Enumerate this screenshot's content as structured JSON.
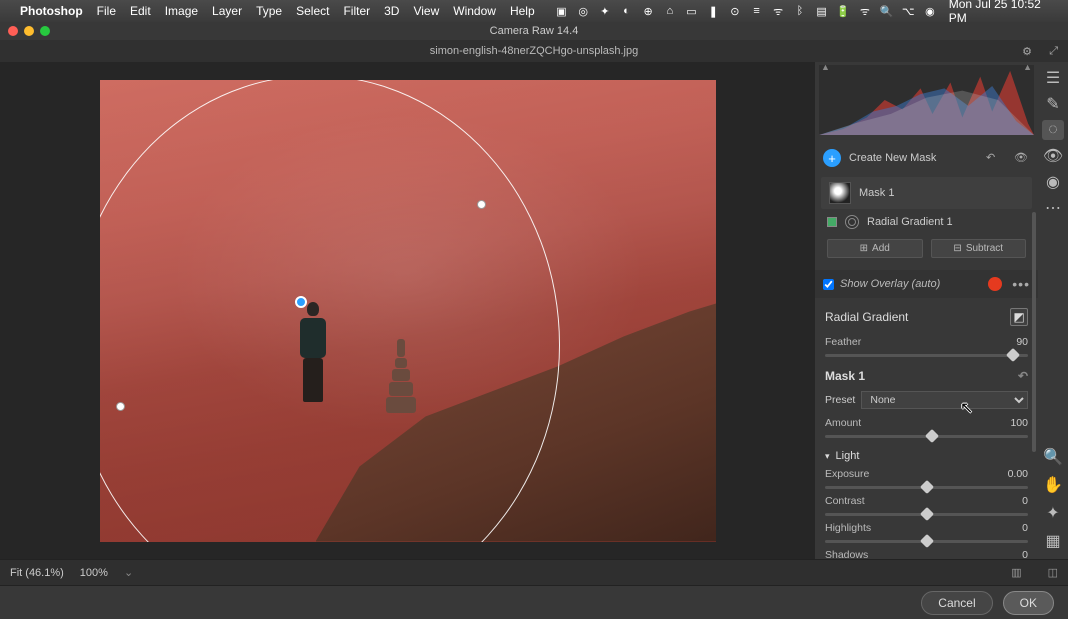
{
  "menubar": {
    "app": "Photoshop",
    "items": [
      "File",
      "Edit",
      "Image",
      "Layer",
      "Type",
      "Select",
      "Filter",
      "3D",
      "View",
      "Window",
      "Help"
    ],
    "clock": "Mon Jul 25  10:52 PM"
  },
  "window": {
    "title": "Camera Raw 14.4",
    "filename": "simon-english-48nerZQCHgo-unsplash.jpg"
  },
  "masking": {
    "create_label": "Create New Mask",
    "mask_name": "Mask 1",
    "gradient_item": "Radial Gradient 1",
    "add_btn": "Add",
    "subtract_btn": "Subtract",
    "overlay_label": "Show Overlay (auto)"
  },
  "radial": {
    "title": "Radial Gradient",
    "feather_label": "Feather",
    "feather_value": "90"
  },
  "mask_adjust": {
    "title": "Mask 1",
    "preset_label": "Preset",
    "preset_value": "None",
    "amount_label": "Amount",
    "amount_value": "100"
  },
  "light": {
    "group": "Light",
    "exposure_label": "Exposure",
    "exposure_value": "0.00",
    "contrast_label": "Contrast",
    "contrast_value": "0",
    "highlights_label": "Highlights",
    "highlights_value": "0",
    "shadows_label": "Shadows",
    "shadows_value": "0"
  },
  "bottom": {
    "fit": "Fit (46.1%)",
    "zoom": "100%"
  },
  "footer": {
    "cancel": "Cancel",
    "ok": "OK"
  }
}
